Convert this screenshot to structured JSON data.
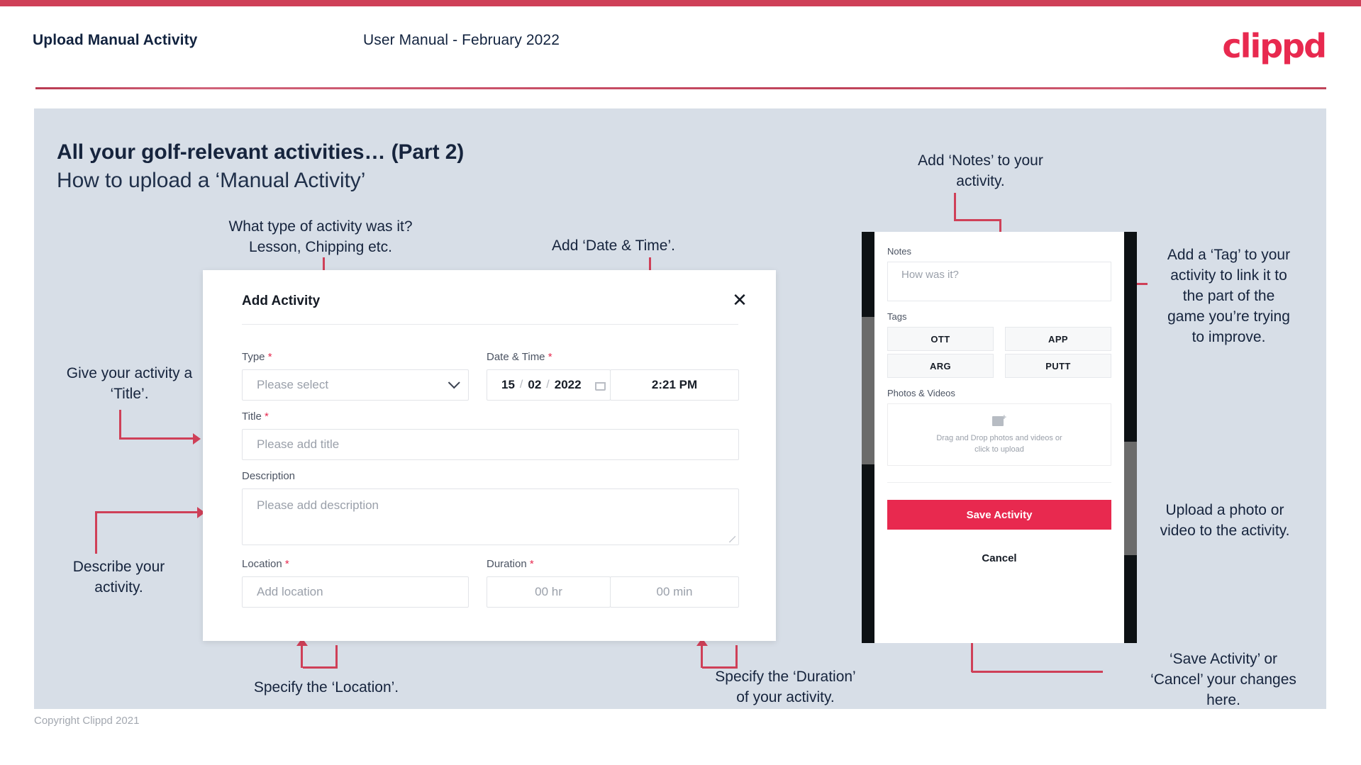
{
  "header": {
    "title": "Upload Manual Activity",
    "subtitle": "User Manual - February 2022",
    "logo": "clippd"
  },
  "page": {
    "heading": "All your golf-relevant activities… (Part 2)",
    "subheading": "How to upload a ‘Manual Activity’",
    "footer": "Copyright Clippd 2021",
    "accent_color": "#cf4058",
    "brand_color": "#e8294f",
    "panel_bg": "#d7dee7"
  },
  "annotations": {
    "type": "What type of activity was it?\nLesson, Chipping etc.",
    "datetime": "Add ‘Date & Time’.",
    "title": "Give your activity a\n‘Title’.",
    "description": "Describe your\nactivity.",
    "location": "Specify the ‘Location’.",
    "duration": "Specify the ‘Duration’\nof your activity.",
    "notes": "Add ‘Notes’ to your\nactivity.",
    "tags": "Add a ‘Tag’ to your\nactivity to link it to\nthe part of the\ngame you’re trying\nto improve.",
    "photos": "Upload a photo or\nvideo to the activity.",
    "save_cancel": "‘Save Activity’ or\n‘Cancel’ your changes\nhere."
  },
  "dialog": {
    "title": "Add Activity",
    "close_icon": "close-icon",
    "fields": {
      "type": {
        "label": "Type",
        "required": "*",
        "placeholder": "Please select",
        "icon": "chevron-down-icon"
      },
      "datetime": {
        "label": "Date & Time",
        "required": "*",
        "day": "15",
        "sep1": "/",
        "month": "02",
        "sep2": "/",
        "year": "2022",
        "icon": "calendar-icon",
        "time": "2:21 PM"
      },
      "title": {
        "label": "Title",
        "required": "*",
        "placeholder": "Please add title"
      },
      "description": {
        "label": "Description",
        "required": "",
        "placeholder": "Please add description"
      },
      "location": {
        "label": "Location",
        "required": "*",
        "placeholder": "Add location"
      },
      "duration": {
        "label": "Duration",
        "required": "*",
        "hours_placeholder": "00 hr",
        "minutes_placeholder": "00 min"
      }
    }
  },
  "phone": {
    "notes": {
      "label": "Notes",
      "placeholder": "How was it?"
    },
    "tags": {
      "label": "Tags",
      "items": [
        "OTT",
        "APP",
        "ARG",
        "PUTT"
      ]
    },
    "photos": {
      "label": "Photos & Videos",
      "icon": "add-image-icon",
      "drop_line1": "Drag and Drop photos and videos or",
      "drop_line2": "click to upload"
    },
    "save_label": "Save Activity",
    "cancel_label": "Cancel"
  }
}
